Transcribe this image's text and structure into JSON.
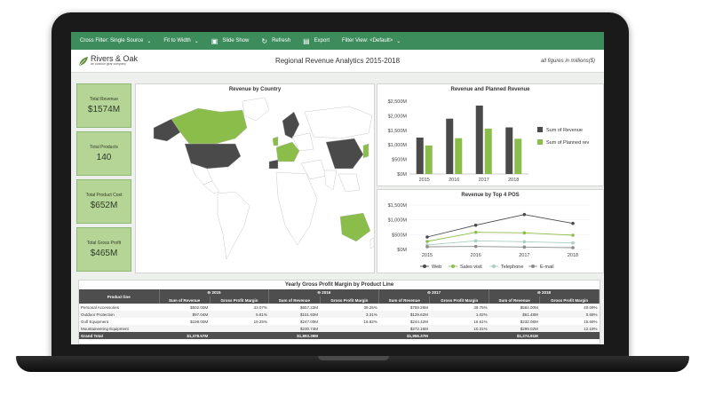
{
  "toolbar": {
    "items": [
      {
        "label": "Cross Filter: Single Source",
        "dropdown": true
      },
      {
        "label": "Fit to Width",
        "dropdown": true
      },
      {
        "label": "Slide Show",
        "icon": "slideshow-icon"
      },
      {
        "label": "Refresh",
        "icon": "refresh-icon"
      },
      {
        "label": "Export",
        "icon": "export-icon"
      },
      {
        "label": "Filter View: <Default>",
        "dropdown": true
      }
    ]
  },
  "header": {
    "logo_name": "Rivers & Oak",
    "logo_tagline": "an outdoor gear company",
    "title": "Regional Revenue Analytics 2015-2018",
    "note": "all figures in millions($)"
  },
  "kpis": [
    {
      "label": "Total Revenue",
      "value": "$1574M"
    },
    {
      "label": "Total Products",
      "value": "140"
    },
    {
      "label": "Total Product Cost",
      "value": "$652M"
    },
    {
      "label": "Total Gross Profit",
      "value": "$465M"
    }
  ],
  "map": {
    "title": "Revenue by Country"
  },
  "colors": {
    "dark": "#4a4a4a",
    "green": "#8bbd4a",
    "toolbar": "#3c8c5c",
    "kpi": "#b5d596"
  },
  "chart_data": [
    {
      "type": "bar",
      "title": "Revenue and Planned Revenue",
      "categories": [
        "2015",
        "2016",
        "2017",
        "2018"
      ],
      "series": [
        {
          "name": "Sum of Revenue",
          "values": [
            1250,
            1900,
            2350,
            1600
          ],
          "color": "#4a4a4a"
        },
        {
          "name": "Sum of Planned rev",
          "values": [
            980,
            1230,
            1560,
            1210
          ],
          "color": "#8bbd4a"
        }
      ],
      "yticks": [
        "$0M",
        "$500M",
        "$1,000M",
        "$1,500M",
        "$2,000M",
        "$2,500M"
      ],
      "ylim": [
        0,
        2500
      ],
      "legend": "right"
    },
    {
      "type": "line",
      "title": "Revenue by Top 4 POS",
      "x": [
        "2015",
        "2016",
        "2017",
        "2018"
      ],
      "series": [
        {
          "name": "Web",
          "values": [
            420,
            820,
            1180,
            880
          ],
          "color": "#4a4a4a"
        },
        {
          "name": "Sales visit",
          "values": [
            270,
            580,
            560,
            480
          ],
          "color": "#8bbd4a"
        },
        {
          "name": "Telephone",
          "values": [
            150,
            290,
            260,
            220
          ],
          "color": "#a8cfc0"
        },
        {
          "name": "E-mail",
          "values": [
            90,
            100,
            80,
            60
          ],
          "color": "#8a8a8a"
        }
      ],
      "yticks": [
        "$0M",
        "$500M",
        "$1,000M",
        "$1,500M"
      ],
      "ylim": [
        0,
        1500
      ],
      "legend": "bottom"
    }
  ],
  "table": {
    "title": "Yearly Gross Profit Margin by Product Line",
    "row_header": "Product line",
    "years": [
      "2015",
      "2016",
      "2017",
      "2018"
    ],
    "sub_headers": [
      "Sum of Revenue",
      "Gross Profit Margin"
    ],
    "rows": [
      {
        "name": "Personal Accessories",
        "cells": [
          "$502.00M",
          "43.07%",
          "$657.22M",
          "39.25%",
          "$759.26M",
          "39.75%",
          "$584.00M",
          "40.09%"
        ]
      },
      {
        "name": "Outdoor Protection",
        "cells": [
          "$97.04M",
          "5.81%",
          "$151.92M",
          "3.31%",
          "$129.62M",
          "1.02%",
          "$61.48M",
          "0.68%"
        ]
      },
      {
        "name": "Golf Equipment",
        "cells": [
          "$198.00M",
          "19.25%",
          "$247.00M",
          "16.82%",
          "$244.42M",
          "16.61%",
          "$232.08M",
          "15.68%"
        ]
      },
      {
        "name": "Mountaineering Equipment",
        "cells": [
          "",
          "",
          "$230.74M",
          "",
          "$272.16M",
          "10.31%",
          "$299.02M",
          "12.19%"
        ]
      }
    ],
    "grand_total": {
      "name": "Grand Total",
      "cells": [
        "$1,378.57M",
        "",
        "$1,893.39M",
        "",
        "$1,955.37M",
        "",
        "$1,274.91M",
        ""
      ]
    }
  }
}
